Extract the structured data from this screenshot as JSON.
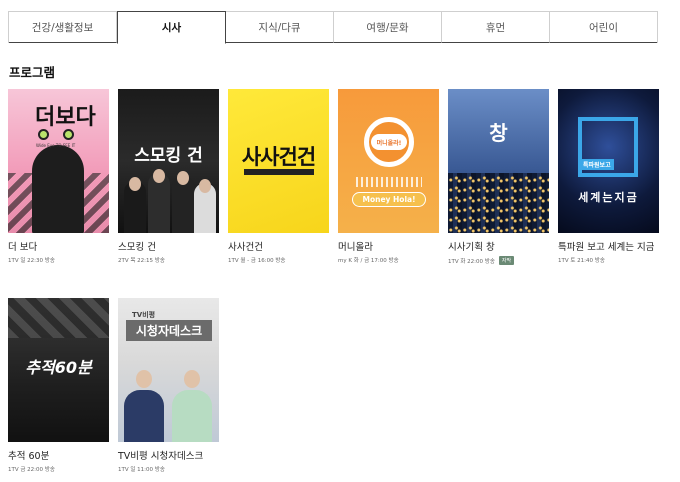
{
  "tabs": [
    {
      "label": "건강/생활정보",
      "active": false
    },
    {
      "label": "시사",
      "active": true
    },
    {
      "label": "지식/다큐",
      "active": false
    },
    {
      "label": "여행/문화",
      "active": false
    },
    {
      "label": "휴먼",
      "active": false
    },
    {
      "label": "어린이",
      "active": false
    }
  ],
  "section": {
    "title": "프로그램"
  },
  "programs": [
    {
      "title": "더 보다",
      "meta": "1TV 일 22:30 방송",
      "poster_text": "더보다",
      "poster_sub": "Wide Eye TO SEE IT"
    },
    {
      "title": "스모킹 건",
      "meta": "2TV 목 22:15 방송",
      "poster_text": "스모킹 건"
    },
    {
      "title": "사사건건",
      "meta": "1TV 월 - 금 16:00 방송",
      "poster_text": "사사건건"
    },
    {
      "title": "머니올라",
      "meta": "my K 화 / 금 17:00 방송",
      "poster_text": "머니올라!",
      "poster_sub": "Money Hola!"
    },
    {
      "title": "시사기획 창",
      "meta": "1TV 화 22:00 방송",
      "badge": "자막",
      "poster_text": "창"
    },
    {
      "title": "특파원 보고 세계는 지금",
      "meta": "1TV 토 21:40 방송",
      "poster_text": "세계는지금",
      "poster_sub": "특파원보고"
    },
    {
      "title": "추적 60분",
      "meta": "1TV 금 22:00 방송",
      "poster_text": "추적60분"
    },
    {
      "title": "TV비평 시청자데스크",
      "meta": "1TV 일 11:00 방송",
      "poster_text": "시청자데스크",
      "poster_sub": "TV비평"
    }
  ]
}
